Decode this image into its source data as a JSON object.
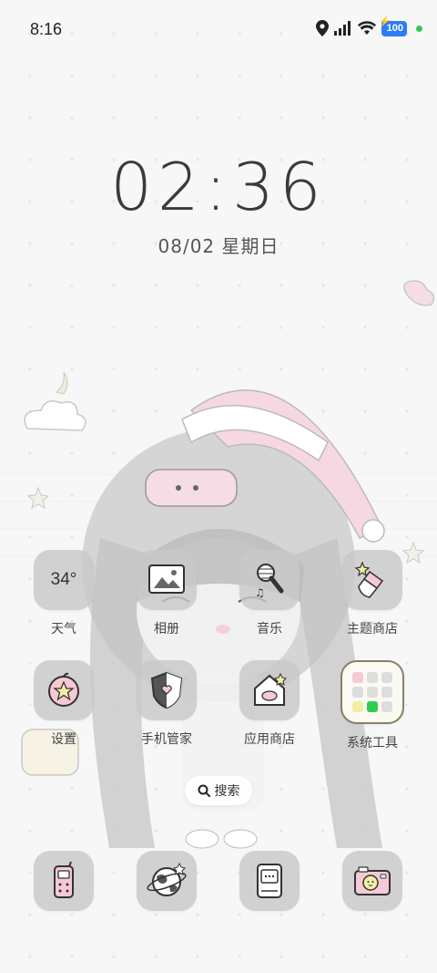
{
  "status_bar": {
    "time": "8:16",
    "battery": "100",
    "icons": [
      "location-icon",
      "signal-icon",
      "wifi-icon",
      "battery-icon",
      "green-dot-indicator"
    ]
  },
  "clock": {
    "time": "02:36",
    "date": "08/02 星期日"
  },
  "apps": [
    {
      "label": "天气",
      "icon": "weather-icon",
      "value": "34°"
    },
    {
      "label": "相册",
      "icon": "gallery-icon"
    },
    {
      "label": "音乐",
      "icon": "music-icon"
    },
    {
      "label": "主题商店",
      "icon": "theme-store-icon"
    },
    {
      "label": "设置",
      "icon": "settings-icon"
    },
    {
      "label": "手机管家",
      "icon": "phone-manager-icon"
    },
    {
      "label": "应用商店",
      "icon": "app-store-icon"
    },
    {
      "label": "系统工具",
      "icon": "system-tools-folder"
    }
  ],
  "search": {
    "label": "搜索"
  },
  "dock": [
    {
      "icon": "phone-icon"
    },
    {
      "icon": "browser-icon"
    },
    {
      "icon": "messages-icon"
    },
    {
      "icon": "camera-icon"
    }
  ],
  "colors": {
    "battery": "#2e7cf6",
    "indicator": "#2ecc52",
    "icon_bg": "#c8c8c8",
    "accent_pink": "#f2c6d4"
  }
}
